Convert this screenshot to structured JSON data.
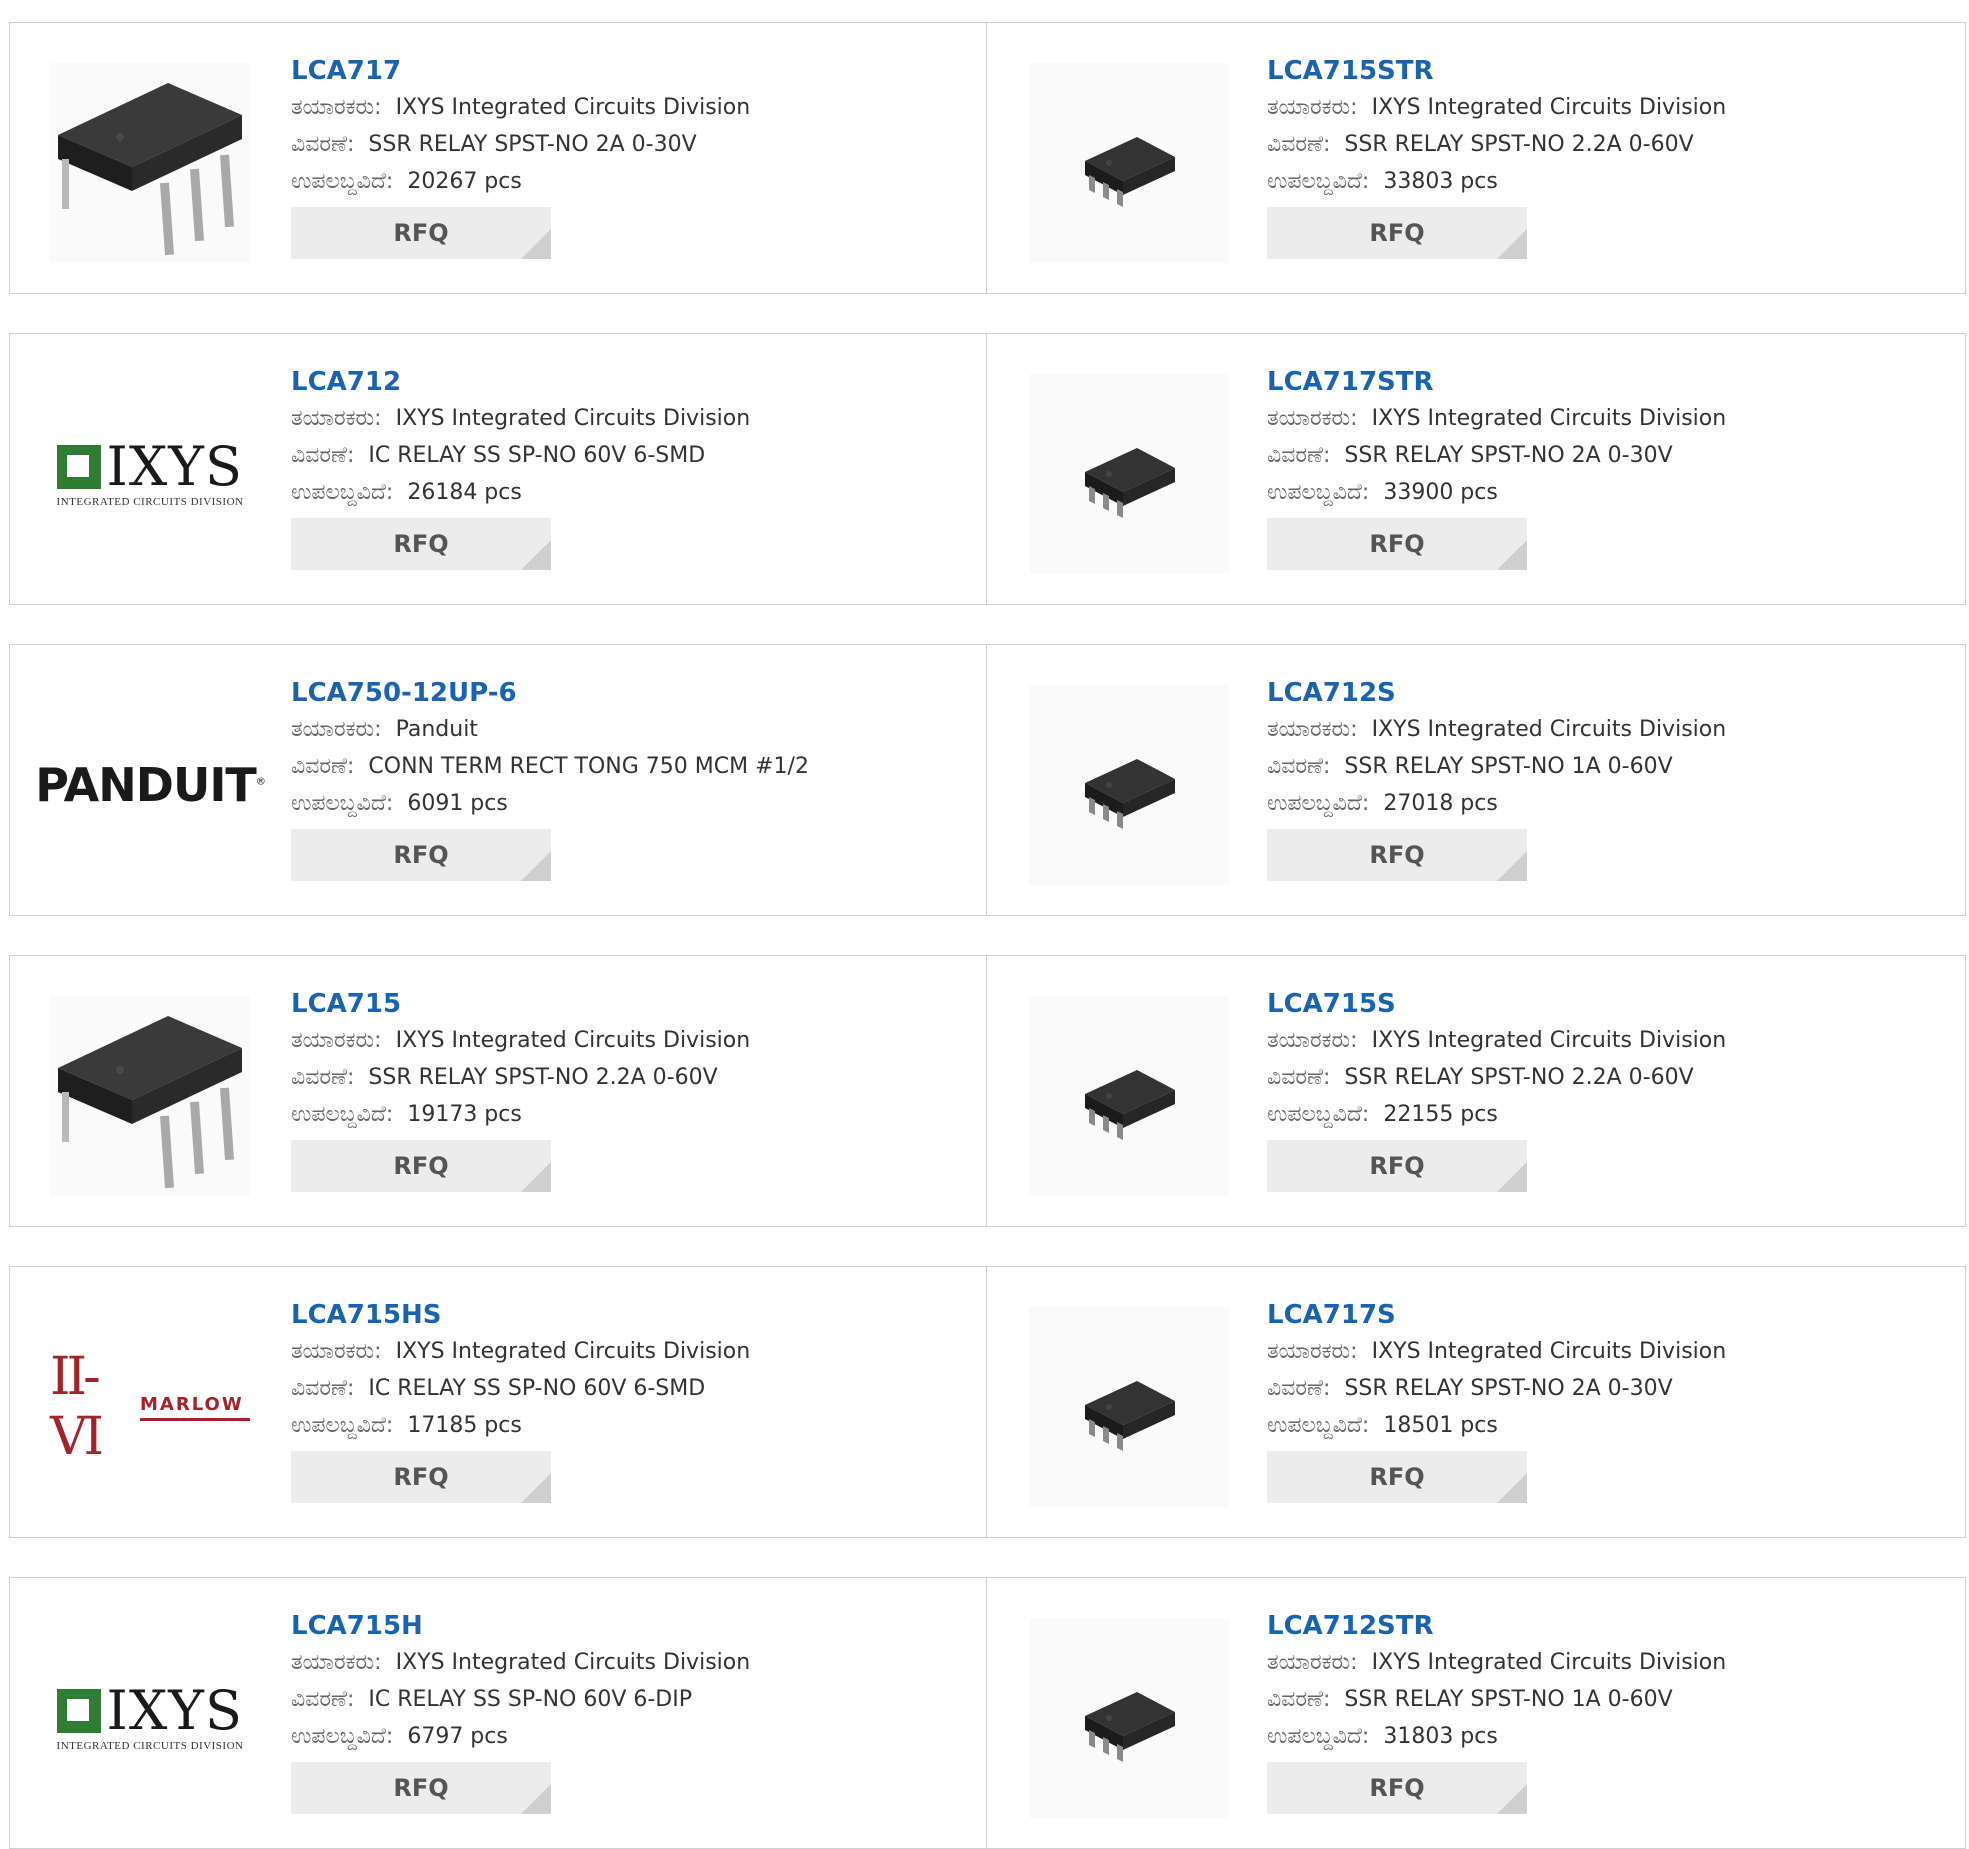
{
  "labels": {
    "manufacturer": "ತಯಾರಕರು:",
    "description": "ವಿವರಣೆ:",
    "available": "ಉಪಲಬ್ದವಿದೆ:"
  },
  "rows": [
    {
      "left": {
        "part": "LCA717",
        "manufacturer": "IXYS Integrated Circuits Division",
        "description": "SSR RELAY SPST-NO 2A 0-30V",
        "stock": "20267 pcs",
        "rfq": "RFQ",
        "image": "dip-chip"
      },
      "right": {
        "part": "LCA715STR",
        "manufacturer": "IXYS Integrated Circuits Division",
        "description": "SSR RELAY SPST-NO 2.2A 0-60V",
        "stock": "33803 pcs",
        "rfq": "RFQ",
        "image": "smd-chip"
      }
    },
    {
      "left": {
        "part": "LCA712",
        "manufacturer": "IXYS Integrated Circuits Division",
        "description": "IC RELAY SS SP-NO 60V 6-SMD",
        "stock": "26184 pcs",
        "rfq": "RFQ",
        "image": "ixys-logo"
      },
      "right": {
        "part": "LCA717STR",
        "manufacturer": "IXYS Integrated Circuits Division",
        "description": "SSR RELAY SPST-NO 2A 0-30V",
        "stock": "33900 pcs",
        "rfq": "RFQ",
        "image": "smd-chip"
      }
    },
    {
      "left": {
        "part": "LCA750-12UP-6",
        "manufacturer": "Panduit",
        "description": "CONN TERM RECT TONG 750 MCM #1/2",
        "stock": "6091 pcs",
        "rfq": "RFQ",
        "image": "panduit-logo"
      },
      "right": {
        "part": "LCA712S",
        "manufacturer": "IXYS Integrated Circuits Division",
        "description": "SSR RELAY SPST-NO 1A 0-60V",
        "stock": "27018 pcs",
        "rfq": "RFQ",
        "image": "smd-chip"
      }
    },
    {
      "left": {
        "part": "LCA715",
        "manufacturer": "IXYS Integrated Circuits Division",
        "description": "SSR RELAY SPST-NO 2.2A 0-60V",
        "stock": "19173 pcs",
        "rfq": "RFQ",
        "image": "dip-chip"
      },
      "right": {
        "part": "LCA715S",
        "manufacturer": "IXYS Integrated Circuits Division",
        "description": "SSR RELAY SPST-NO 2.2A 0-60V",
        "stock": "22155 pcs",
        "rfq": "RFQ",
        "image": "smd-chip"
      }
    },
    {
      "left": {
        "part": "LCA715HS",
        "manufacturer": "IXYS Integrated Circuits Division",
        "description": "IC RELAY SS SP-NO 60V 6-SMD",
        "stock": "17185 pcs",
        "rfq": "RFQ",
        "image": "marlow-logo"
      },
      "right": {
        "part": "LCA717S",
        "manufacturer": "IXYS Integrated Circuits Division",
        "description": "SSR RELAY SPST-NO 2A 0-30V",
        "stock": "18501 pcs",
        "rfq": "RFQ",
        "image": "smd-chip"
      }
    },
    {
      "left": {
        "part": "LCA715H",
        "manufacturer": "IXYS Integrated Circuits Division",
        "description": "IC RELAY SS SP-NO 60V 6-DIP",
        "stock": "6797 pcs",
        "rfq": "RFQ",
        "image": "ixys-logo"
      },
      "right": {
        "part": "LCA712STR",
        "manufacturer": "IXYS Integrated Circuits Division",
        "description": "SSR RELAY SPST-NO 1A 0-60V",
        "stock": "31803 pcs",
        "rfq": "RFQ",
        "image": "smd-chip"
      }
    }
  ],
  "logos": {
    "ixys_word": "IXYS",
    "ixys_sub": "Integrated Circuits Division",
    "panduit_word": "PANDUIT",
    "marlow_mark": "II-VI",
    "marlow_word": "MARLOW"
  },
  "colors": {
    "link": "#1a63b0",
    "border": "#cfcfcf",
    "button_bg": "#ececec",
    "marlow_red": "#a3232b",
    "ixys_green": "#2e7d32"
  }
}
